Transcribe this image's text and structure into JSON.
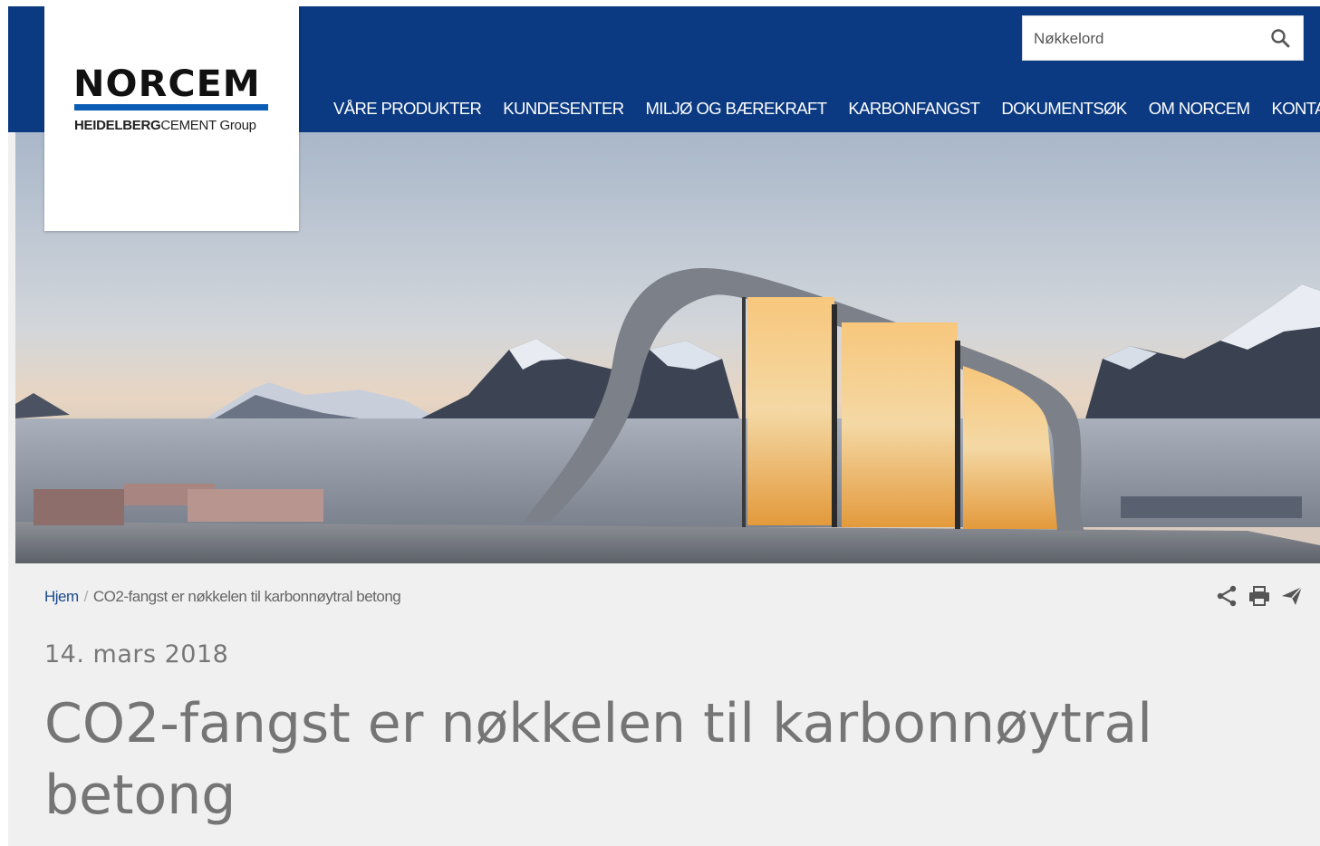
{
  "brand": {
    "logo_text": "NORCEM",
    "logo_sub_bold": "HEIDELBERG",
    "logo_sub_regular": "CEMENT Group",
    "color_primary": "#0b3a82",
    "color_logo_bar": "#0b5cb5"
  },
  "search": {
    "placeholder": "Nøkkelord",
    "icon": "search-icon"
  },
  "nav": {
    "items": [
      {
        "label": "VÅRE PRODUKTER"
      },
      {
        "label": "KUNDESENTER"
      },
      {
        "label": "MILJØ OG BÆREKRAFT"
      },
      {
        "label": "KARBONFANGST"
      },
      {
        "label": "DOKUMENTSØK"
      },
      {
        "label": "OM NORCEM"
      },
      {
        "label": "KONTAKT"
      }
    ]
  },
  "breadcrumb": {
    "home": "Hjem",
    "separator": "/",
    "current": "CO2-fangst er nøkkelen til karbonnøytral betong"
  },
  "tools": {
    "icons": [
      "share-icon",
      "print-icon",
      "send-icon"
    ]
  },
  "article": {
    "date": "14. mars 2018",
    "title": "CO2-fangst er nøkkelen til karbonnøytral betong"
  }
}
